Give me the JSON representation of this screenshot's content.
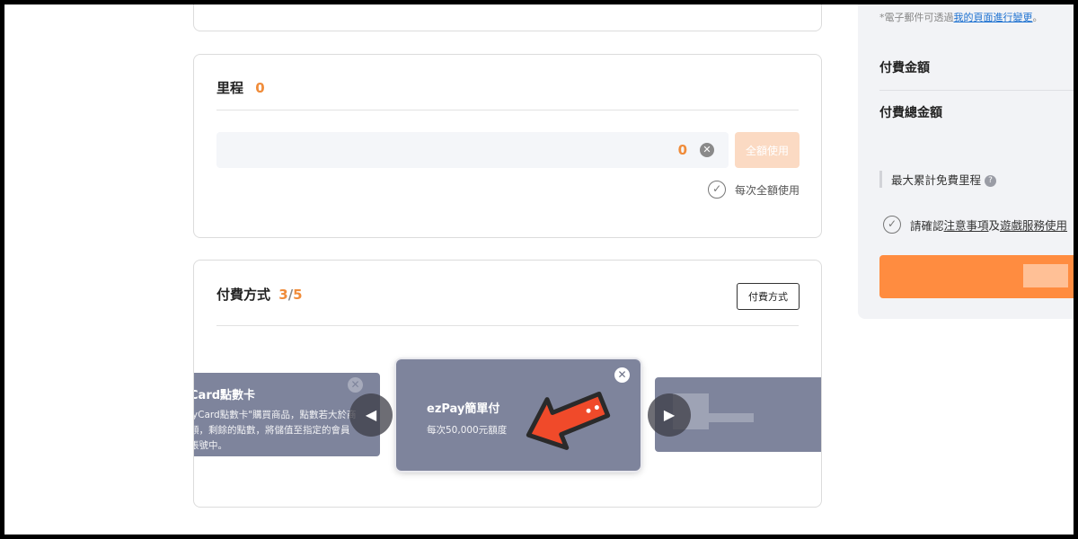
{
  "miles": {
    "title": "里程",
    "count": "0",
    "value": "0",
    "clear_icon": "close-icon",
    "use_all_label": "全額使用",
    "each_time_label": "每次全額使用"
  },
  "payment": {
    "title": "付費方式",
    "current": "3",
    "total": "5",
    "method_button": "付費方式",
    "slides": {
      "left_title": "Card點數卡",
      "left_lines": [
        "lyCard點數卡\"購買商品，點數若大於商",
        "額，剩餘的點數，將儲值至指定的會員",
        "帳號中。"
      ],
      "center_title": "ezPay簡單付",
      "center_desc": "每次50,000元額度"
    }
  },
  "sidebar": {
    "note_prefix": "*電子郵件可透過",
    "note_link": "我的頁面進行變更",
    "note_suffix": "。",
    "pay_amount": "付費金額",
    "pay_total": "付費總金額",
    "max_miles": "最大累計免費里程",
    "confirm_prefix": "請確認",
    "confirm_link1": "注意事項",
    "confirm_mid": "及",
    "confirm_link2": "遊戲服務使用"
  },
  "colors": {
    "accent": "#f08c3a",
    "submit": "#ff8c40",
    "slide_bg": "#7e849c"
  }
}
